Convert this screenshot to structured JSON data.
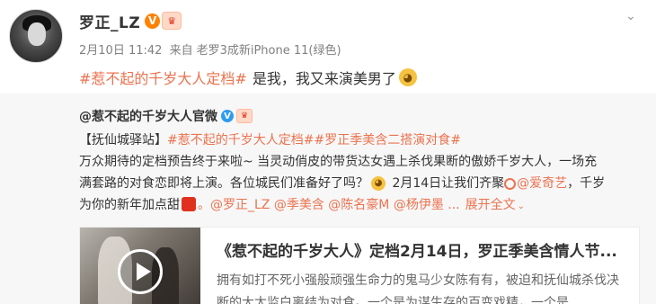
{
  "post": {
    "author": "罗正_LZ",
    "time": "2月10日 11:42",
    "source_prefix": "来自",
    "source": "老罗3成新iPhone 11(绿色)",
    "topic": "#惹不起的千岁大人定档#",
    "text": "是我，我又来演美男了"
  },
  "repost": {
    "author": "@惹不起的千岁大人官微",
    "line2_prefix": "【抚仙城驿站】",
    "line2_topics": "#惹不起的千岁大人定档##罗正季美含二搭演对食#",
    "line3": "万众期待的定档预告终于来啦~ 当灵动俏皮的带货达女遇上杀伐果断的傲娇千岁大人，一场充",
    "line4_a": "满套路的对食恋即将上演。各位城民们准备好了吗？",
    "line4_b": " 2月14日让我们齐聚",
    "line4_at": "@爱奇艺",
    "line4_c": "，千岁",
    "line5_a": "为你的新年加点甜",
    "line5_mentions": "。@罗正_LZ @季美含 @陈名豪M @杨伊墨 ...",
    "expand_label": "展开全文"
  },
  "card": {
    "title": "《惹不起的千岁大人》定档2月14日，罗正季美含情人节...",
    "description": "拥有如打不死小强般顽强生命力的鬼马少女陈有有，被迫和抚仙城杀伐决断的大太监白离结为对食。一个是为谋生存的百变戏精，一个是"
  },
  "icons": {
    "more": "chevron-down-icon",
    "verified_orange": "vip-badge-icon",
    "verified_blue": "blue-v-badge-icon",
    "play": "play-icon"
  }
}
